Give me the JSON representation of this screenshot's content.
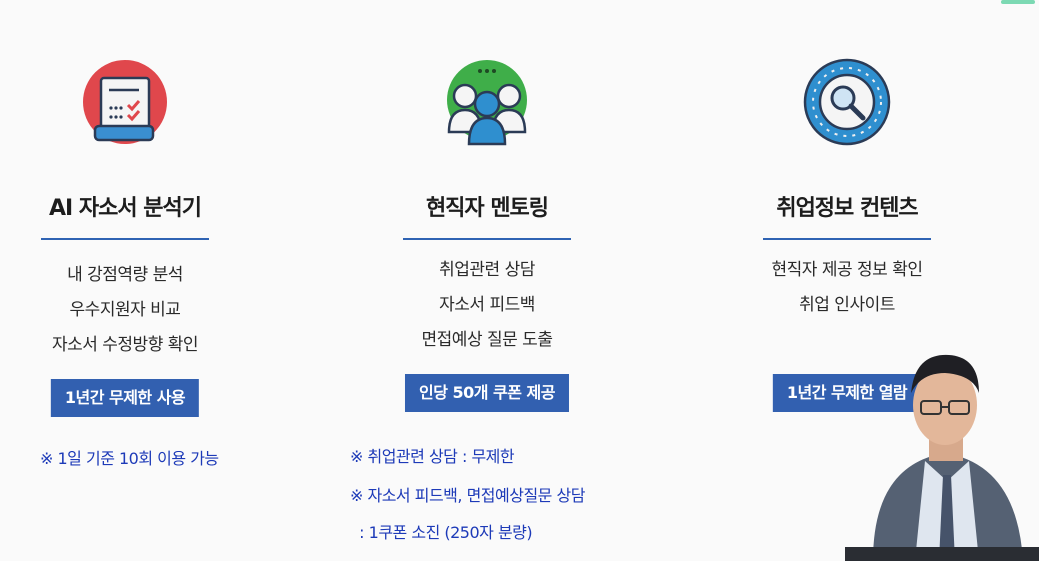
{
  "columns": [
    {
      "title": "AI 자소서 분석기",
      "features": [
        "내 강점역량 분석",
        "우수지원자 비교",
        "자소서 수정방향 확인"
      ],
      "badge": "1년간 무제한 사용",
      "notes": [
        "※ 1일 기준 10회 이용 가능"
      ],
      "icon": "document-checklist-icon"
    },
    {
      "title": "현직자 멘토링",
      "features": [
        "취업관련 상담",
        "자소서 피드백",
        "면접예상 질문 도출"
      ],
      "badge": "인당 50개 쿠폰 제공",
      "notes": [
        "※ 취업관련 상담 : 무제한",
        "※ 자소서 피드백, 면접예상질문 상담",
        "  : 1쿠폰 소진 (250자 분량)"
      ],
      "icon": "mentoring-group-icon"
    },
    {
      "title": "취업정보 컨텐츠",
      "features": [
        "현직자 제공 정보 확인",
        "취업 인사이트"
      ],
      "badge": "1년간 무제한 열람",
      "notes": [],
      "icon": "magnifier-icon"
    }
  ],
  "colors": {
    "accent": "#3260b0",
    "note": "#1d3ab8",
    "icon_red": "#e0474c",
    "icon_green": "#3fae49",
    "icon_blue": "#2f8fcf"
  }
}
